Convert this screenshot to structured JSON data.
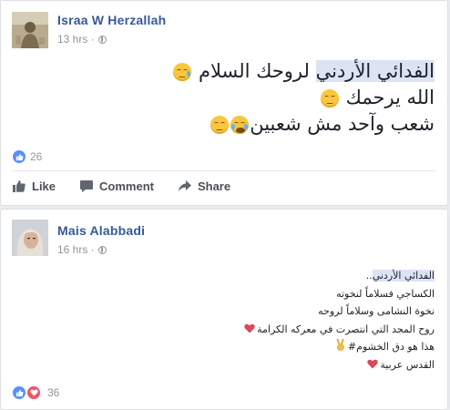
{
  "post1": {
    "author": "Israa W Herzallah",
    "time": "13 hrs · ",
    "line1_highlight": "الفدائي الأردني",
    "line1_rest": " لروحك السلام ",
    "line2": "الله يرحمك ",
    "line3": "شعب وآحد مش شعبين",
    "reaction_count": "26",
    "actions": {
      "like": "Like",
      "comment": "Comment",
      "share": "Share"
    }
  },
  "post2": {
    "author": "Mais Alabbadi",
    "time": "16 hrs · ",
    "line1_highlight": "الفدائي الأردني",
    "line1_rest": "..",
    "line2": "الكساجي فسلاماً لنخوته",
    "line3": "نخوة النشامى وسلاماً لروحه",
    "line4": "روح المجد التي انتصرت في معركه الكرامة",
    "line5": "هذا هو دق الخشوم#",
    "line6": "القدس عربية",
    "reaction_count": "36"
  },
  "colors": {
    "link": "#365899",
    "like": "#5890ff",
    "love": "#f25268",
    "highlight": "#dce3f5"
  }
}
